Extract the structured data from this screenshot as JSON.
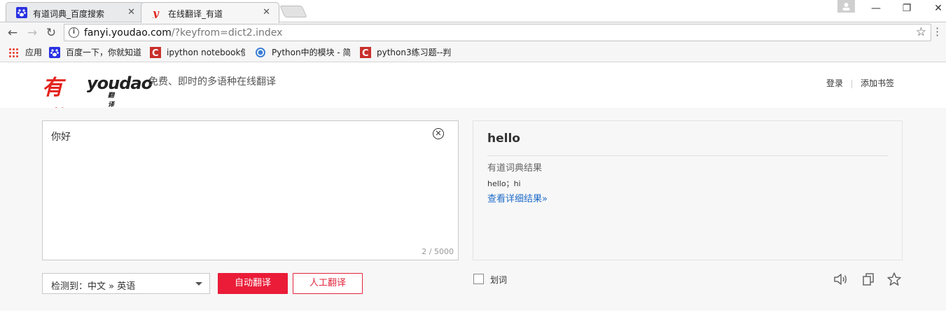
{
  "browser": {
    "tabs": [
      {
        "title": "有道词典_百度搜索",
        "close": "✕"
      },
      {
        "title": "在线翻译_有道",
        "close": "✕"
      }
    ],
    "window_controls": {
      "minimize": "—",
      "restore": "❐",
      "close": "✕"
    },
    "address_bar": {
      "url_host": "fanyi.youdao.com",
      "url_rest": "/?keyfrom=dict2.index"
    },
    "bookmarks": [
      {
        "label": "应用",
        "icon": "apps-grid-icon"
      },
      {
        "label": "百度一下，你就知道",
        "icon": "baidu-paw-icon"
      },
      {
        "label": "ipython notebook使",
        "icon": "csdn-c-icon"
      },
      {
        "label": "Python中的模块 - 简",
        "icon": "globe-icon"
      },
      {
        "label": "python3练习题--判",
        "icon": "csdn-c-icon"
      }
    ],
    "colors": {
      "csdn_red": "#c9302c",
      "baidu_blue": "#2932e1",
      "youdao_red": "#e3231c"
    }
  },
  "header": {
    "logo_cn": "有道",
    "logo_en": "youdao",
    "logo_sub": "翻 译",
    "slogan": "免费、即时的多语种在线翻译",
    "login": "登录",
    "bookmark": "添加书签"
  },
  "translator": {
    "input_text": "你好",
    "clear_icon": "⊗",
    "char_count": "2 / 5000",
    "language_select": "检测到：中文 » 英语",
    "auto_translate_button": "自动翻译",
    "human_translate_button": "人工翻译",
    "result_word": "hello",
    "dict_title": "有道词典结果",
    "dict_meaning": "hello；hi",
    "more_link": "查看详细结果»",
    "select_word_label": "划词",
    "accent_color": "#ea1c38",
    "link_color": "#1f6cc9"
  }
}
